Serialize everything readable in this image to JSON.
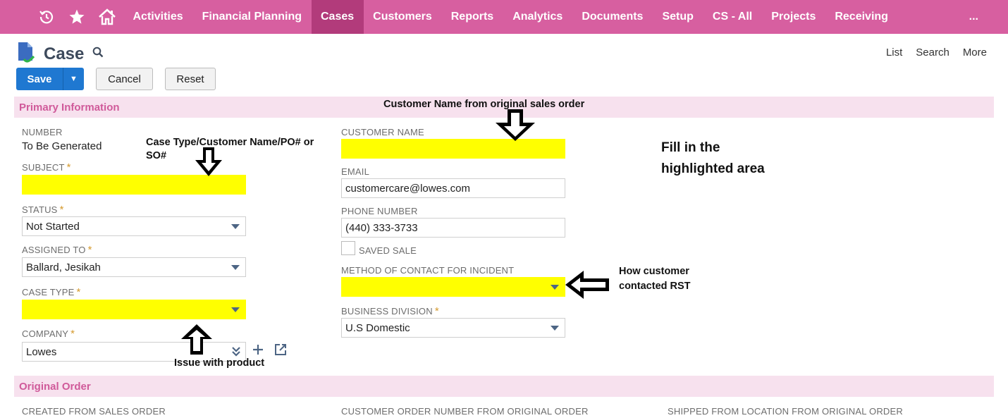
{
  "nav": {
    "icons": [
      "recent-icon",
      "star-icon",
      "home-icon"
    ],
    "items": [
      "Activities",
      "Financial Planning",
      "Cases",
      "Customers",
      "Reports",
      "Analytics",
      "Documents",
      "Setup",
      "CS - All",
      "Projects",
      "Receiving"
    ],
    "active": "Cases",
    "more": "..."
  },
  "page": {
    "title": "Case",
    "links": {
      "list": "List",
      "search": "Search",
      "more": "More"
    }
  },
  "buttons": {
    "save": "Save",
    "cancel": "Cancel",
    "reset": "Reset"
  },
  "sections": {
    "primary": "Primary Information",
    "original": "Original Order"
  },
  "fields": {
    "number": {
      "label": "NUMBER",
      "value": "To Be Generated"
    },
    "subject": {
      "label": "SUBJECT",
      "required": "*",
      "value": ""
    },
    "status": {
      "label": "STATUS",
      "required": "*",
      "value": "Not Started"
    },
    "assigned_to": {
      "label": "ASSIGNED TO",
      "required": "*",
      "value": "Ballard, Jesikah"
    },
    "case_type": {
      "label": "CASE TYPE",
      "required": "*",
      "value": ""
    },
    "company": {
      "label": "COMPANY",
      "required": "*",
      "value": "Lowes"
    },
    "customer_name": {
      "label": "CUSTOMER NAME",
      "value": ""
    },
    "email": {
      "label": "EMAIL",
      "value": "customercare@lowes.com"
    },
    "phone": {
      "label": "PHONE NUMBER",
      "value": "(440) 333-3733"
    },
    "saved_sale": {
      "label": "SAVED SALE",
      "checked": false
    },
    "method_of_contact": {
      "label": "METHOD OF CONTACT FOR INCIDENT",
      "value": ""
    },
    "business_division": {
      "label": "BUSINESS DIVISION",
      "required": "*",
      "value": "U.S Domestic"
    },
    "created_from_so": {
      "label": "CREATED FROM SALES ORDER"
    },
    "customer_order_number": {
      "label": "CUSTOMER ORDER NUMBER FROM ORIGINAL ORDER"
    },
    "shipped_from_location": {
      "label": "SHIPPED FROM LOCATION FROM ORIGINAL ORDER"
    }
  },
  "annotations": {
    "customer_name_hint": "Customer Name from original sales order",
    "subject_hint_line1": "Case Type/Customer Name/PO# or",
    "subject_hint_line2": "SO#",
    "fill_line1": "Fill in the",
    "fill_line2": "highlighted area",
    "contact_line1": "How customer",
    "contact_line2": "contacted RST",
    "case_type_hint": "Issue with product"
  },
  "colors": {
    "nav": "#d75fa0",
    "nav_active": "#b23b7b",
    "highlight": "#ffff00",
    "section_bg": "#f7e1ee",
    "section_text": "#d05a9a",
    "save": "#1f78d1"
  }
}
